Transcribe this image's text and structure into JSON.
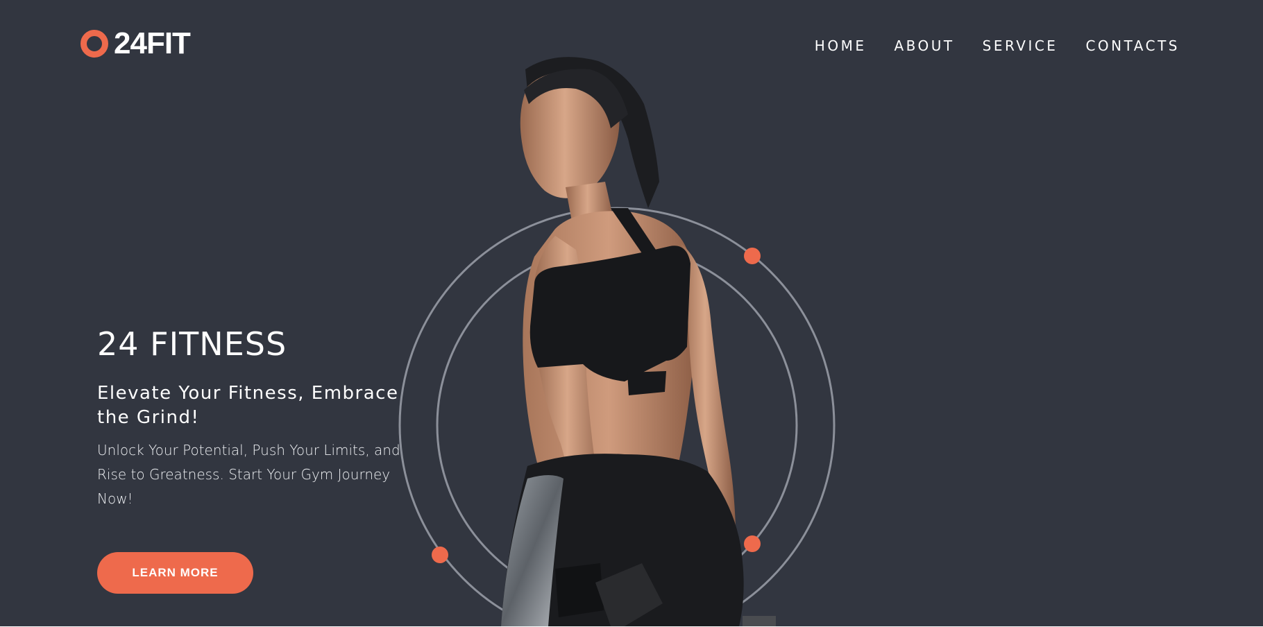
{
  "brand": {
    "name": "24FIT",
    "accent_color": "#ee6a4c",
    "background_color": "#323640"
  },
  "nav": {
    "items": [
      "HOME",
      "ABOUT",
      "SERVICE",
      "CONTACTS"
    ]
  },
  "hero": {
    "title": "24 FITNESS",
    "subtitle": "Elevate Your Fitness, Embrace the Grind!",
    "description": "Unlock Your Potential, Push Your Limits, and Rise to Greatness. Start Your Gym Journey Now!",
    "cta_label": "LEARN MORE",
    "image_alt": "Woman in black sportswear holding a dumbbell",
    "icons": {
      "logo": "ring-logo-icon",
      "orbit": "orbit-rings-decoration"
    }
  }
}
